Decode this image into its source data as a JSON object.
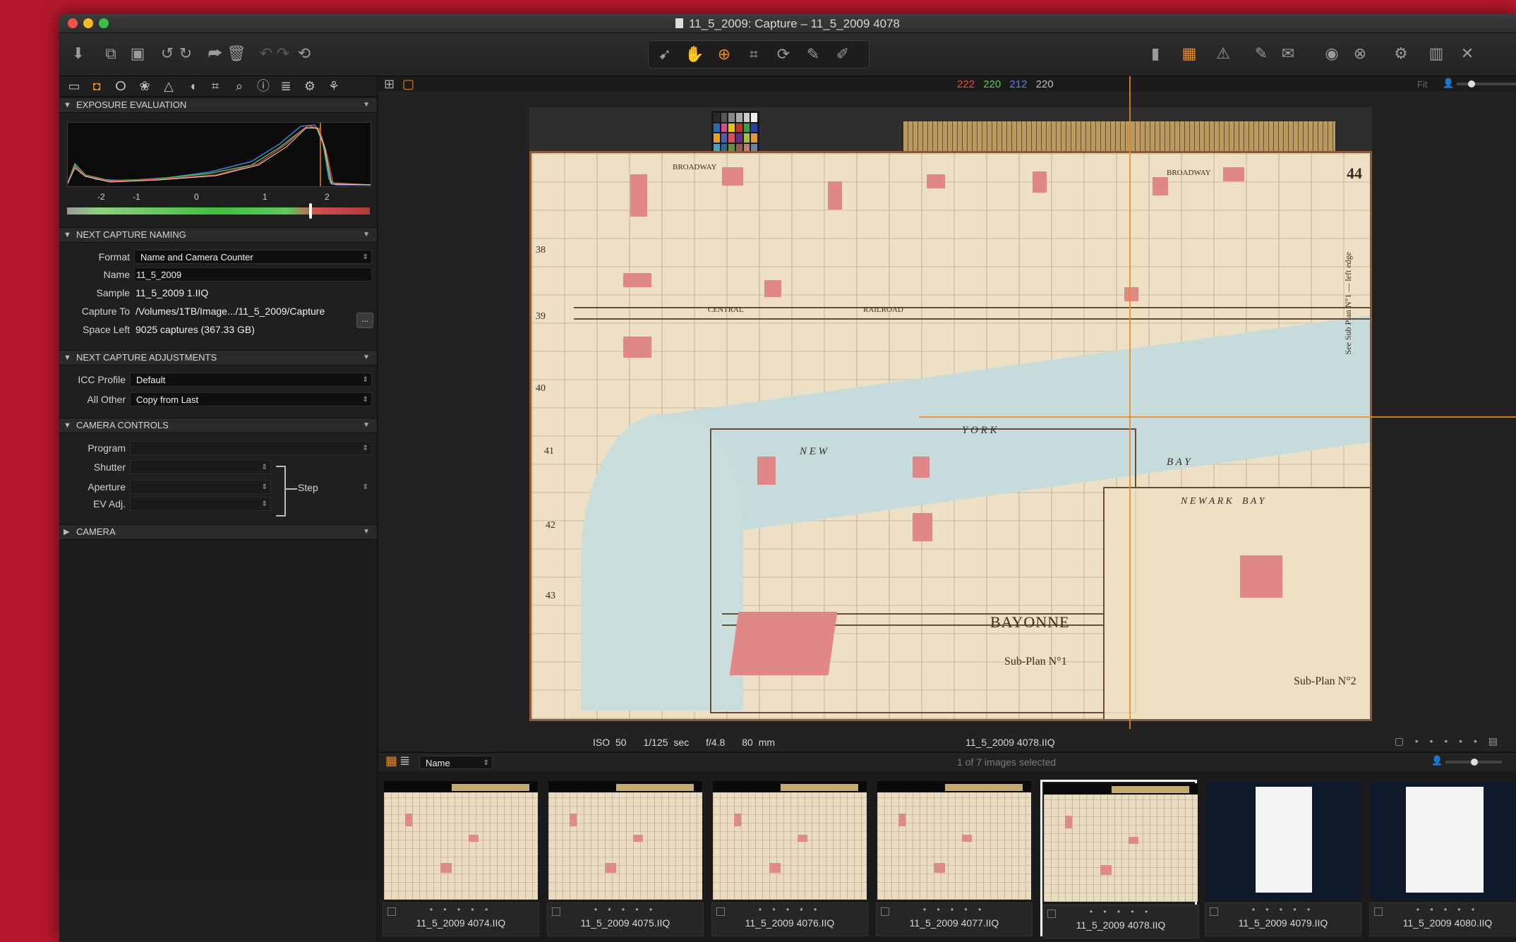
{
  "window": {
    "title": "11_5_2009: Capture – 11_5_2009 4078"
  },
  "toolbar": {
    "left_icons": [
      "import-icon",
      "capture-icon",
      "live-view-icon",
      "rotate-left-icon",
      "rotate-right-icon",
      "move-to-icon",
      "trash-icon",
      "undo-icon",
      "redo-icon",
      "reset-icon"
    ],
    "center_icons": [
      "cursor-select-icon",
      "hand-pan-icon",
      "zoom-icon",
      "crop-icon",
      "rotate-icon",
      "color-picker-icon",
      "annotate-icon"
    ],
    "right_icons": [
      "single-view-icon",
      "grid-overlay-icon",
      "warning-icon",
      "edit-icon",
      "process-icon",
      "camera-icon",
      "clear-icon",
      "settings-icon",
      "workspace-icon",
      "close-x-icon"
    ]
  },
  "tool_tabs": [
    "folder",
    "capture",
    "search",
    "color",
    "exposure",
    "lens",
    "crop",
    "magnify",
    "metadata",
    "batch",
    "adjustments",
    "styles"
  ],
  "exposure_evaluation": {
    "title": "EXPOSURE EVALUATION",
    "ticks": [
      "-2",
      "-1",
      "0",
      "1",
      "2"
    ],
    "marker_value": 1.7
  },
  "naming": {
    "title": "NEXT CAPTURE NAMING",
    "format_label": "Format",
    "format_value": "Name and Camera Counter",
    "name_label": "Name",
    "name_value": "11_5_2009",
    "sample_label": "Sample",
    "sample_value": "11_5_2009 1.IIQ",
    "capture_to_label": "Capture To",
    "capture_to_value": "/Volumes/1TB/Image.../11_5_2009/Capture",
    "browse_label": "...",
    "space_left_label": "Space Left",
    "space_left_value": "9025 captures (367.33 GB)"
  },
  "adjustments": {
    "title": "NEXT CAPTURE ADJUSTMENTS",
    "icc_label": "ICC Profile",
    "icc_value": "Default",
    "other_label": "All Other",
    "other_value": "Copy from Last"
  },
  "camera_controls": {
    "title": "CAMERA CONTROLS",
    "program_label": "Program",
    "shutter_label": "Shutter",
    "aperture_label": "Aperture",
    "ev_label": "EV Adj.",
    "step_label": "Step"
  },
  "camera_section": {
    "title": "CAMERA"
  },
  "viewer": {
    "rgb": {
      "r": "222",
      "g": "220",
      "b": "212",
      "k": "220"
    },
    "iso": "ISO 50",
    "shutter": "1/125 sec",
    "aperture": "f/4.8",
    "focal": "80 mm",
    "filename": "11_5_2009 4078.IIQ",
    "fit_label": "Fit"
  },
  "map_labels": {
    "broadway": "BROADWAY",
    "central": "CENTRAL",
    "railroad": "RAILROAD",
    "new": "N E W",
    "york": "Y O R K",
    "bay": "B A Y",
    "newark_bay": "N E W A R K    B A Y",
    "bayonne": "BAYONNE",
    "subplan1": "Sub-Plan N°1",
    "subplan2": "Sub-Plan N°2",
    "plate_num": "44",
    "side_note": "See Sub Plan N°1 — left edge",
    "rows": [
      "38",
      "39",
      "40",
      "41",
      "42",
      "43"
    ]
  },
  "browser": {
    "sort_label": "Name",
    "selection": "1 of 7 images selected",
    "thumbnails": [
      {
        "name": "11_5_2009 4074.IIQ",
        "selected": false,
        "kind": "map"
      },
      {
        "name": "11_5_2009 4075.IIQ",
        "selected": false,
        "kind": "map"
      },
      {
        "name": "11_5_2009 4076.IIQ",
        "selected": false,
        "kind": "map"
      },
      {
        "name": "11_5_2009 4077.IIQ",
        "selected": false,
        "kind": "map"
      },
      {
        "name": "11_5_2009 4078.IIQ",
        "selected": true,
        "kind": "map"
      },
      {
        "name": "11_5_2009 4079.IIQ",
        "selected": false,
        "kind": "doc"
      },
      {
        "name": "11_5_2009 4080.IIQ",
        "selected": false,
        "kind": "doc"
      }
    ]
  },
  "colors": {
    "accent": "#f08a17",
    "window_bg": "#1a1a1a",
    "desktop": "#b5182d",
    "rgb_r": "#e84a3a",
    "rgb_g": "#55d14c",
    "rgb_b": "#5a7cf0",
    "rgb_k": "#bdbdbd"
  }
}
